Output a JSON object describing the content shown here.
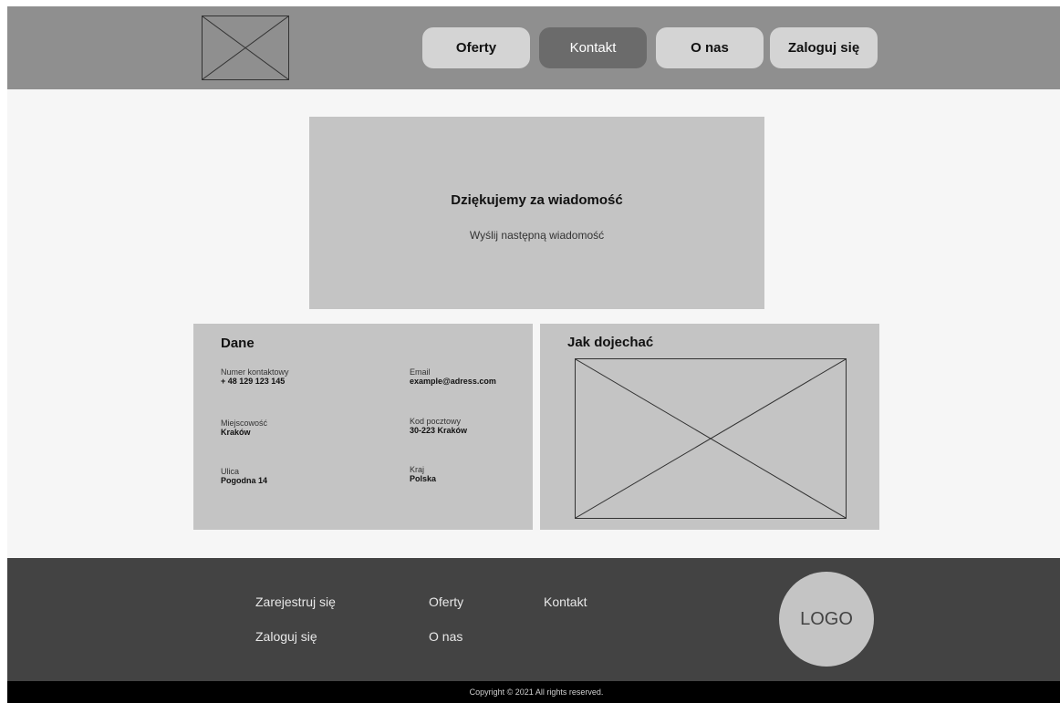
{
  "header": {
    "nav": [
      {
        "label": "Oferty",
        "active": false
      },
      {
        "label": "Kontakt",
        "active": true
      },
      {
        "label": "O nas",
        "active": false
      },
      {
        "label": "Zaloguj się",
        "active": false
      }
    ]
  },
  "thanks": {
    "title": "Dziękujemy za wiadomość",
    "link": "Wyślij następną wiadomość"
  },
  "dane": {
    "title": "Dane",
    "fields": [
      {
        "label": "Numer kontaktowy",
        "value": "+ 48 129 123 145"
      },
      {
        "label": "Email",
        "value": "example@adress.com"
      },
      {
        "label": "Miejscowość",
        "value": "Kraków"
      },
      {
        "label": "Kod pocztowy",
        "value": "30-223 Kraków"
      },
      {
        "label": "Ulica",
        "value": "Pogodna 14"
      },
      {
        "label": "Kraj",
        "value": "Polska"
      }
    ]
  },
  "directions": {
    "title": "Jak dojechać"
  },
  "footer": {
    "links": {
      "register": "Zarejestruj się",
      "offers": "Oferty",
      "contact": "Kontakt",
      "login": "Zaloguj się",
      "about": "O nas"
    },
    "logo": "LOGO",
    "copyright": "Copyright © 2021 All rights reserved."
  },
  "colors": {
    "header_bg": "#8f8f8f",
    "active_nav": "#6b6b6b",
    "panel_bg": "#c4c4c4",
    "footer_bg": "#434343"
  }
}
